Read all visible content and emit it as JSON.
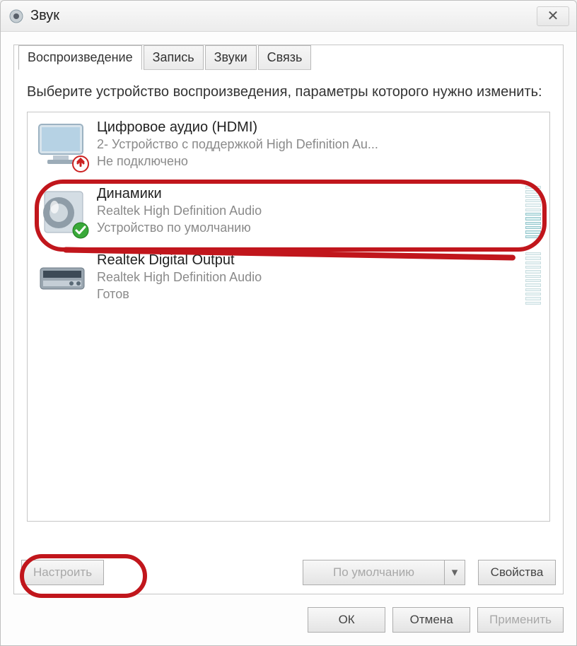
{
  "window": {
    "title": "Звук",
    "close_glyph": "✕"
  },
  "tabs": {
    "playback": "Воспроизведение",
    "recording": "Запись",
    "sounds": "Звуки",
    "comm": "Связь"
  },
  "instruction": "Выберите устройство воспроизведения, параметры которого нужно изменить:",
  "devices": [
    {
      "name": "Цифровое аудио (HDMI)",
      "sub": "2- Устройство с поддержкой High Definition Au...",
      "status": "Не подключено"
    },
    {
      "name": "Динамики",
      "sub": "Realtek High Definition Audio",
      "status": "Устройство по умолчанию"
    },
    {
      "name": "Realtek Digital Output",
      "sub": "Realtek High Definition Audio",
      "status": "Готов"
    }
  ],
  "buttons": {
    "configure": "Настроить",
    "set_default": "По умолчанию",
    "properties": "Свойства",
    "ok": "ОК",
    "cancel": "Отмена",
    "apply": "Применить"
  },
  "icons": {
    "dropdown_glyph": "▾"
  }
}
